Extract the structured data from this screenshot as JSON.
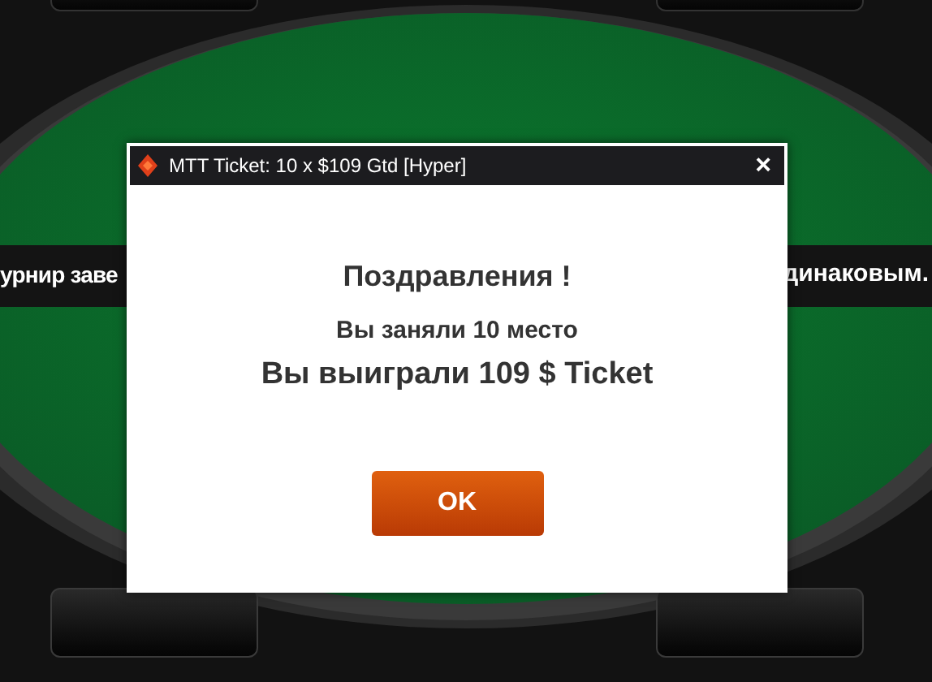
{
  "banner": {
    "left_text": "урнир заве",
    "right_text": "динаковым."
  },
  "dialog": {
    "title": "MTT Ticket: 10 x $109 Gtd [Hyper]",
    "close": "×",
    "heading": "Поздравления !",
    "place": "Вы заняли 10 место",
    "prize": "Вы выиграли 109 $ Ticket",
    "buttons": [
      "OK"
    ]
  }
}
